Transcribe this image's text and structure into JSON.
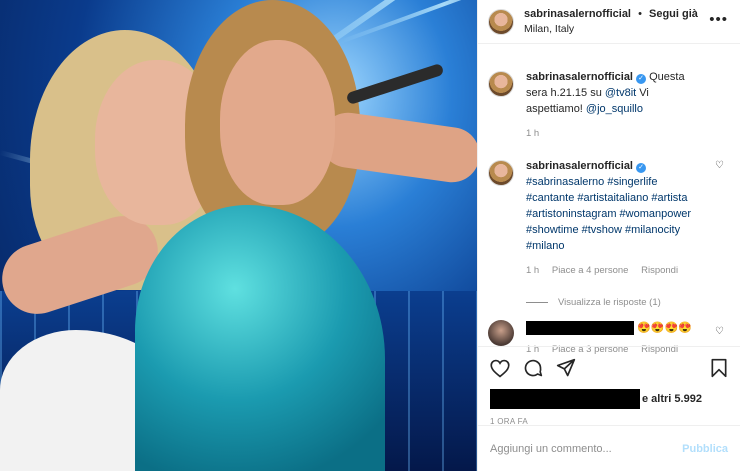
{
  "post": {
    "username": "sabrinasalernofficial",
    "follow_label": "Segui già",
    "separator": "•",
    "location": "Milan, Italy",
    "more": "•••"
  },
  "caption": {
    "username": "sabrinasalernofficial",
    "text_1": "Questa sera h.21.15 su ",
    "mention_1": "@tv8it",
    "text_2": " Vi aspettiamo! ",
    "mention_2": "@jo_squillo",
    "time": "1 h"
  },
  "comments": [
    {
      "username": "sabrinasalernofficial",
      "hashtags": "#sabrinasalerno #singerlife #cantante #artistaitaliano #artista #artistoninstagram #womanpower #showtime #tvshow #milanocity #milano",
      "time": "1 h",
      "likes": "Piace a 4 persone",
      "reply": "Rispondi",
      "view_replies": "Visualizza le risposte (1)"
    },
    {
      "text": "😍😍😍😍",
      "time": "1 h",
      "likes": "Piace a 3 persone",
      "reply": "Rispondi"
    }
  ],
  "likes_summary": "e altri 5.992",
  "posted_ago": "1 ORA FA",
  "add_comment": {
    "placeholder": "Aggiungi un commento...",
    "publish": "Pubblica"
  },
  "colors": {
    "verified": "#3897f0",
    "link": "#00376b",
    "publish_disabled": "#b2dffc"
  }
}
